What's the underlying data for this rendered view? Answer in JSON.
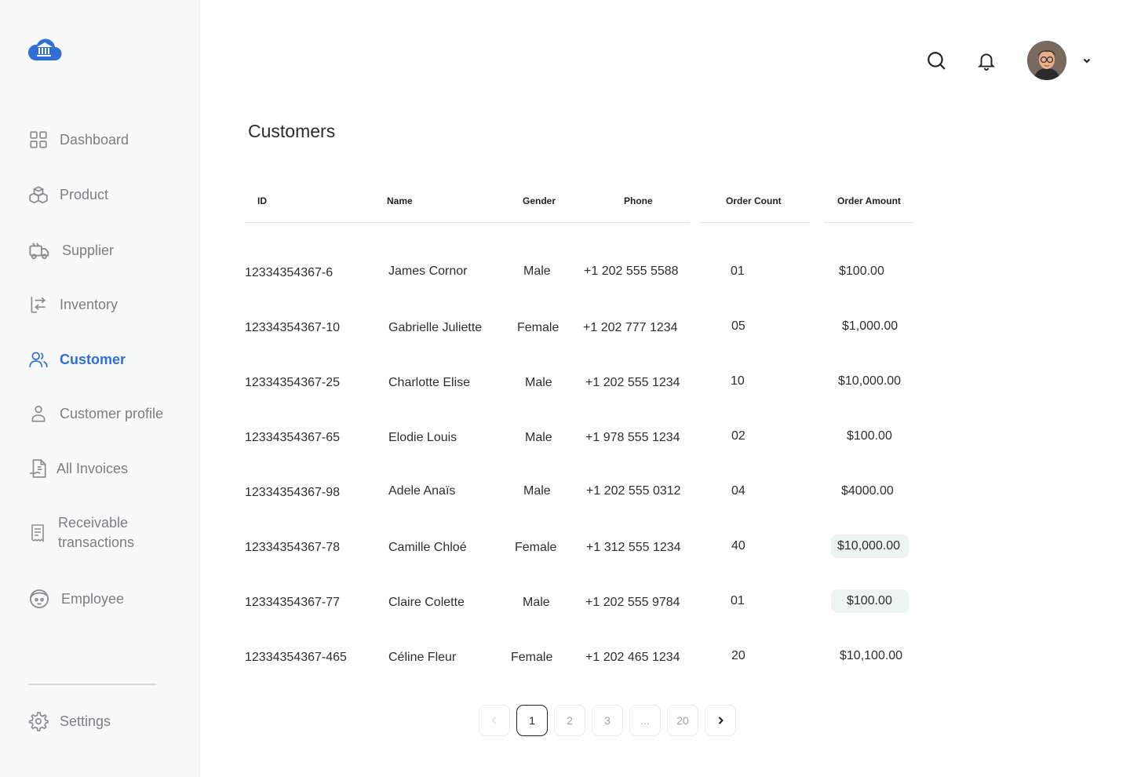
{
  "sidebar": {
    "logo_icon": "bank-cloud-logo",
    "brand_color": "#2f6ed7",
    "items": [
      {
        "label": "Dashboard",
        "icon": "grid-icon"
      },
      {
        "label": "Product",
        "icon": "boxes-icon"
      },
      {
        "label": "Supplier",
        "icon": "truck-icon"
      },
      {
        "label": "Inventory",
        "icon": "transfer-icon"
      },
      {
        "label": "Customer",
        "icon": "users-icon",
        "active": true
      },
      {
        "label": "Customer profile",
        "icon": "user-icon"
      },
      {
        "label": "All Invoices",
        "icon": "invoice-icon"
      },
      {
        "label": "Receivable\ntransactions",
        "icon": "receipt-icon"
      },
      {
        "label": "Employee",
        "icon": "employee-icon"
      }
    ],
    "settings_label": "Settings"
  },
  "header": {
    "search_icon": "search-icon",
    "notification_icon": "bell-icon",
    "avatar": "user-avatar",
    "menu_icon": "chevron-down-icon"
  },
  "page": {
    "title": "Customers"
  },
  "table": {
    "columns": [
      "ID",
      "Name",
      "Gender",
      "Phone",
      "Order Count",
      "Order Amount"
    ],
    "rows": [
      {
        "id": "12334354367-6",
        "name": "James Cornor",
        "gender": "Male",
        "phone": "+1 202 555 5588",
        "count": "01",
        "amount": "$100.00",
        "highlight": false
      },
      {
        "id": "12334354367-10",
        "name": "Gabrielle Juliette",
        "gender": "Female",
        "phone": "+1 202 777 1234",
        "count": "05",
        "amount": "$1,000.00",
        "highlight": false
      },
      {
        "id": "12334354367-25",
        "name": "Charlotte Elise",
        "gender": "Male",
        "phone": "+1 202 555 1234",
        "count": "10",
        "amount": "$10,000.00",
        "highlight": false
      },
      {
        "id": "12334354367-65",
        "name": "Elodie Louis",
        "gender": "Male",
        "phone": "+1 978 555 1234",
        "count": "02",
        "amount": "$100.00",
        "highlight": false
      },
      {
        "id": "12334354367-98",
        "name": "Adele Anaïs",
        "gender": "Male",
        "phone": "+1 202 555 0312",
        "count": "04",
        "amount": "$4000.00",
        "highlight": false
      },
      {
        "id": "12334354367-78",
        "name": "Camille Chloé",
        "gender": "Female",
        "phone": "+1 312 555 1234",
        "count": "40",
        "amount": "$10,000.00",
        "highlight": true
      },
      {
        "id": "12334354367-77",
        "name": "Claire Colette",
        "gender": "Male",
        "phone": "+1 202 555 9784",
        "count": "01",
        "amount": "$100.00",
        "highlight": true
      },
      {
        "id": "12334354367-465",
        "name": "Céline Fleur",
        "gender": "Female",
        "phone": "+1 202 465 1234",
        "count": "20",
        "amount": "$10,100.00",
        "highlight": false
      }
    ],
    "highlight_color": "#ecf6ef"
  },
  "pagination": {
    "pages": [
      "1",
      "2",
      "3",
      "...",
      "20"
    ],
    "current": "1",
    "prev_icon": "chevron-left-icon",
    "next_icon": "chevron-right-icon"
  }
}
